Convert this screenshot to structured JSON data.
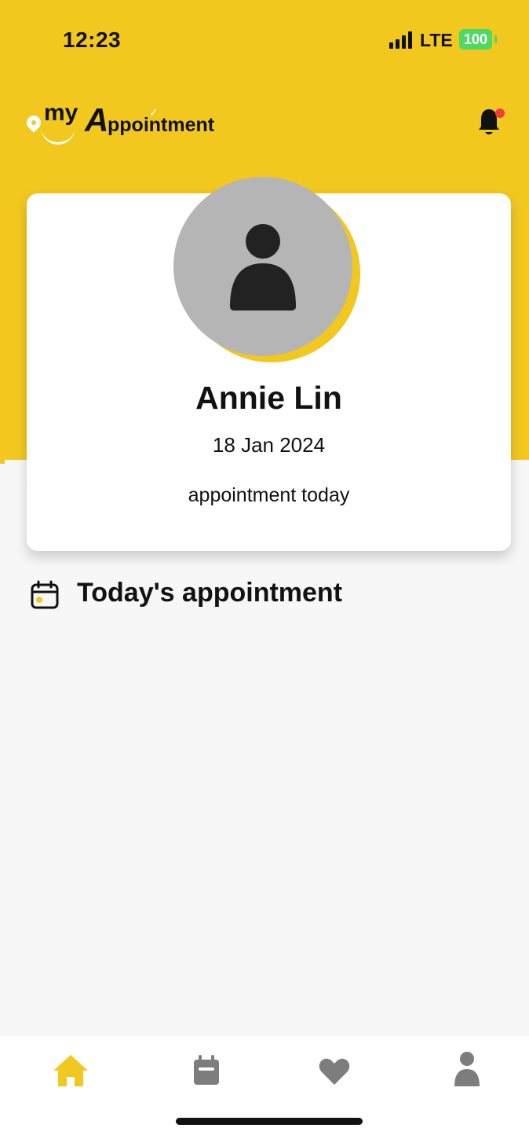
{
  "status_bar": {
    "time": "12:23",
    "network": "LTE",
    "battery": "100"
  },
  "header": {
    "logo": {
      "my": "my",
      "big_letter": "A",
      "rest": "ppointment"
    }
  },
  "profile": {
    "name": "Annie Lin",
    "date": "18 Jan 2024",
    "status": "appointment today"
  },
  "section": {
    "title": "Today's appointment"
  },
  "tab_bar": {
    "tabs": [
      {
        "icon": "home-icon",
        "active": true
      },
      {
        "icon": "calendar-icon",
        "active": false
      },
      {
        "icon": "heart-icon",
        "active": false
      },
      {
        "icon": "person-icon",
        "active": false
      }
    ]
  },
  "colors": {
    "brand_yellow": "#f2c81f",
    "inactive_icon": "#7d7d7d",
    "avatar_grey": "#b5b5b5",
    "notification_dot": "#f23b3b"
  }
}
